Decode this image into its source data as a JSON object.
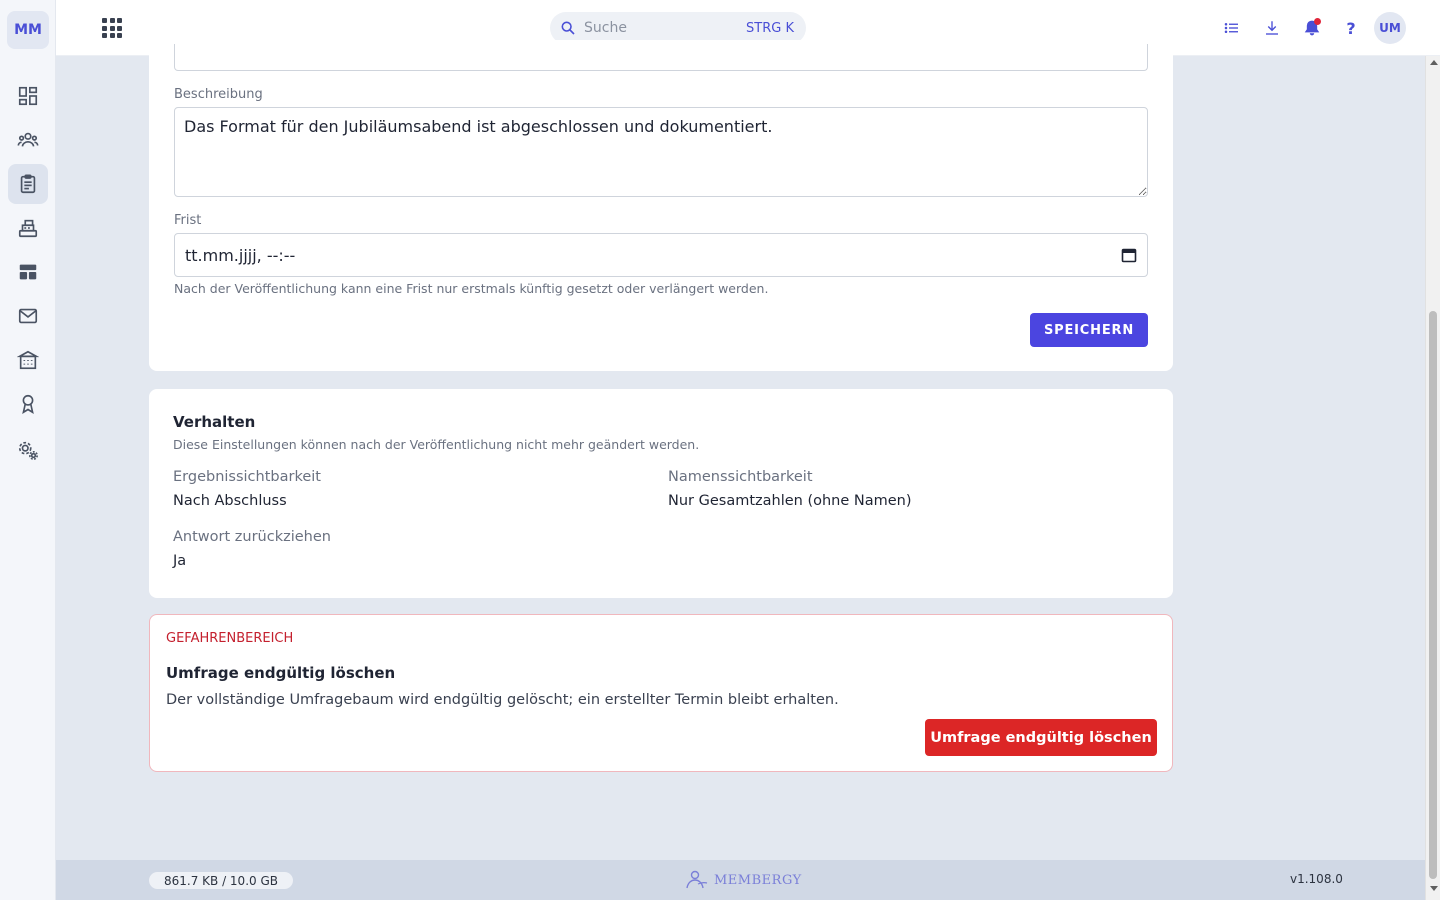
{
  "sidebar": {
    "logo": "MM",
    "items": [
      {
        "name": "dashboard-icon"
      },
      {
        "name": "members-icon"
      },
      {
        "name": "surveys-icon",
        "active": true
      },
      {
        "name": "cash-register-icon"
      },
      {
        "name": "layout-icon"
      },
      {
        "name": "mail-icon"
      },
      {
        "name": "organization-icon"
      },
      {
        "name": "award-icon"
      },
      {
        "name": "settings-icon"
      }
    ]
  },
  "topbar": {
    "search_placeholder": "Suche",
    "search_shortcut": "STRG K",
    "help_label": "?",
    "avatar": "UM",
    "accent_color": "#4b45e0"
  },
  "form": {
    "description_label": "Beschreibung",
    "description_value": "Das Format für den Jubiläumsabend ist abgeschlossen und dokumentiert.",
    "deadline_label": "Frist",
    "deadline_value": "tt.mm.jjjj, --:--",
    "deadline_hint": "Nach der Veröffentlichung kann eine Frist nur erstmals künftig gesetzt oder verlängert werden.",
    "save_label": "SPEICHERN"
  },
  "behavior": {
    "title": "Verhalten",
    "subtitle": "Diese Einstellungen können nach der Veröffentlichung nicht mehr geändert werden.",
    "result_visibility_label": "Ergebnissichtbarkeit",
    "result_visibility_value": "Nach Abschluss",
    "name_visibility_label": "Namenssichtbarkeit",
    "name_visibility_value": "Nur Gesamtzahlen (ohne Namen)",
    "withdraw_label": "Antwort zurückziehen",
    "withdraw_value": "Ja"
  },
  "danger": {
    "section_label": "GEFAHRENBEREICH",
    "title": "Umfrage endgültig löschen",
    "text": "Der vollständige Umfragebaum wird endgültig gelöscht; ein erstellter Termin bleibt erhalten.",
    "button_label": "Umfrage endgültig löschen",
    "color": "#dc2626"
  },
  "footer": {
    "storage": "861.7 KB / 10.0 GB",
    "brand": "MEMBERGY",
    "version": "v1.108.0"
  }
}
